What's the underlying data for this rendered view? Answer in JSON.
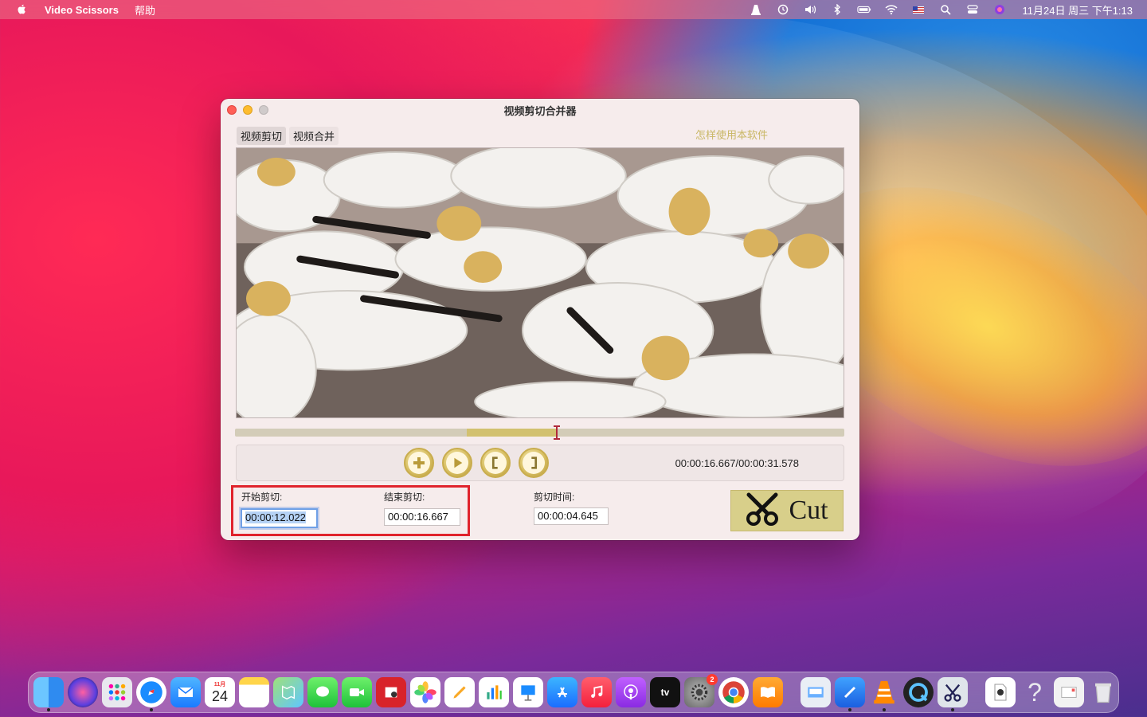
{
  "menubar": {
    "app_name": "Video Scissors",
    "menus": [
      "帮助"
    ],
    "clock": "11月24日 周三 下午1:13"
  },
  "window": {
    "title": "视频剪切合并器",
    "tabs": [
      {
        "label": "视频剪切",
        "active": true
      },
      {
        "label": "视频合并",
        "active": false
      }
    ],
    "help_link": "怎样使用本软件",
    "timeline": {
      "selection_start_fraction": 0.381,
      "selection_end_fraction": 0.528,
      "playhead_fraction": 0.528,
      "accent_color": "#d2c170"
    },
    "controls": {
      "buttons": [
        "add-icon",
        "play-icon",
        "mark-in-icon",
        "mark-out-icon"
      ],
      "time_readout": "00:00:16.667/00:00:31.578"
    },
    "cut_start_label": "开始剪切:",
    "cut_start_value": "00:00:12.022",
    "cut_end_label": "结束剪切:",
    "cut_end_value": "00:00:16.667",
    "duration_label": "剪切时间:",
    "duration_value": "00:00:04.645",
    "cut_button_label": "Cut",
    "highlight_color": "#e0232c"
  },
  "dock": {
    "calendar_month": "11月",
    "calendar_day": "24",
    "settings_badge": "2",
    "apps": [
      "finder",
      "siri",
      "launchpad",
      "safari",
      "mail",
      "calendar",
      "notes",
      "maps",
      "messages",
      "facetime",
      "photo-booth",
      "photos",
      "pages-pencil",
      "numbers",
      "keynote",
      "app-store",
      "music",
      "podcasts",
      "apple-tv",
      "system-preferences",
      "chrome",
      "books",
      "preview",
      "xcode",
      "vlc",
      "quicktime",
      "video-scissors",
      "mp4-file",
      "help",
      "email-stamp",
      "trash"
    ]
  }
}
